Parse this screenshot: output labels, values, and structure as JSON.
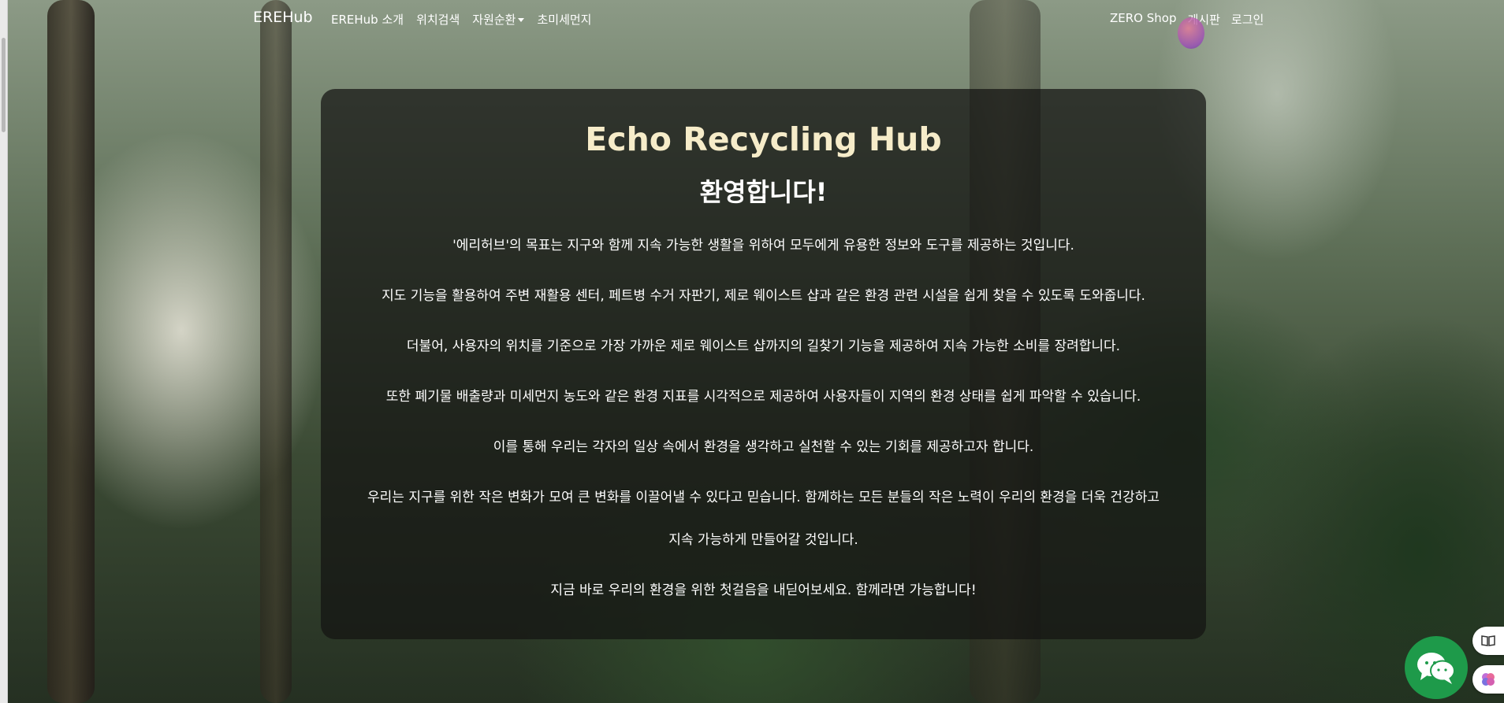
{
  "navbar": {
    "brand": "EREHub",
    "left_links": [
      "EREHub 소개",
      "위치검색",
      "자원순환",
      "초미세먼지"
    ],
    "right_links": [
      "ZERO Shop",
      "게시판",
      "로그인"
    ]
  },
  "hero": {
    "title": "Echo Recycling Hub",
    "subtitle": "환영합니다!",
    "paragraphs": [
      "'에리허브'의 목표는 지구와 함께 지속 가능한 생활을 위하여 모두에게 유용한 정보와 도구를 제공하는 것입니다.",
      "지도 기능을 활용하여 주변 재활용 센터, 페트병 수거 자판기, 제로 웨이스트 샵과 같은 환경 관련 시설을 쉽게 찾을 수 있도록 도와줍니다.",
      "더불어, 사용자의 위치를 기준으로 가장 가까운 제로 웨이스트 샵까지의 길찾기 기능을 제공하여 지속 가능한 소비를 장려합니다.",
      "또한 폐기물 배출량과 미세먼지 농도와 같은 환경 지표를 시각적으로 제공하여 사용자들이 지역의 환경 상태를 쉽게 파악할 수 있습니다.",
      "이를 통해 우리는 각자의 일상 속에서 환경을 생각하고 실천할 수 있는 기회를 제공하고자 합니다.",
      "우리는 지구를 위한 작은 변화가 모여 큰 변화를 이끌어낼 수 있다고 믿습니다. 함께하는 모든 분들의 작은 노력이 우리의 환경을 더욱 건강하고",
      "지속 가능하게 만들어갈 것입니다.",
      "지금 바로 우리의 환경을 위한 첫걸음을 내딛어보세요. 함께라면 가능합니다!"
    ]
  },
  "widgets": {
    "chat_icon": "chat-bubbles-icon",
    "side_icons": [
      "book-icon",
      "brain-icon"
    ]
  },
  "colors": {
    "title": "#f6ecc9",
    "card_bg": "rgba(20,20,18,0.72)",
    "chat_green": "#1e9a4a"
  }
}
